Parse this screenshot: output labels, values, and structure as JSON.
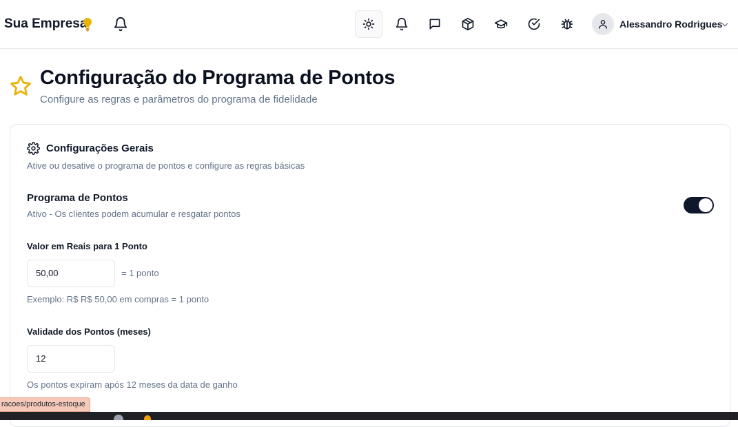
{
  "header": {
    "brand": "Sua Empresa",
    "user_name": "Alessandro Rodrigues",
    "icons": [
      "lightbulb-icon",
      "bell-icon",
      "sun-icon",
      "bell-icon",
      "message-icon",
      "package-icon",
      "graduation-cap-icon",
      "check-circle-icon",
      "bug-icon",
      "user-icon",
      "chevron-down-icon"
    ]
  },
  "page": {
    "title": "Configuração do Programa de Pontos",
    "subtitle": "Configure as regras e parâmetros do programa de fidelidade"
  },
  "card": {
    "title": "Configurações Gerais",
    "description": "Ative ou desative o programa de pontos e configure as regras básicas",
    "program": {
      "label": "Programa de Pontos",
      "status": "Ativo - Os clientes podem acumular e resgatar pontos",
      "enabled": true
    },
    "value_field": {
      "label": "Valor em Reais para 1 Ponto",
      "value": "50,00",
      "suffix": "= 1 ponto",
      "hint": "Exemplo: R$ R$ 50,00 em compras = 1 ponto"
    },
    "validity_field": {
      "label": "Validade dos Pontos (meses)",
      "value": "12",
      "hint": "Os pontos expiram após 12 meses da data de ganho"
    }
  },
  "status_bar": {
    "url": "racoes/produtos-estoque"
  },
  "colors": {
    "accent": "#0f172a",
    "star": "#eab308",
    "muted": "#64748b",
    "border": "#e5e7eb"
  }
}
